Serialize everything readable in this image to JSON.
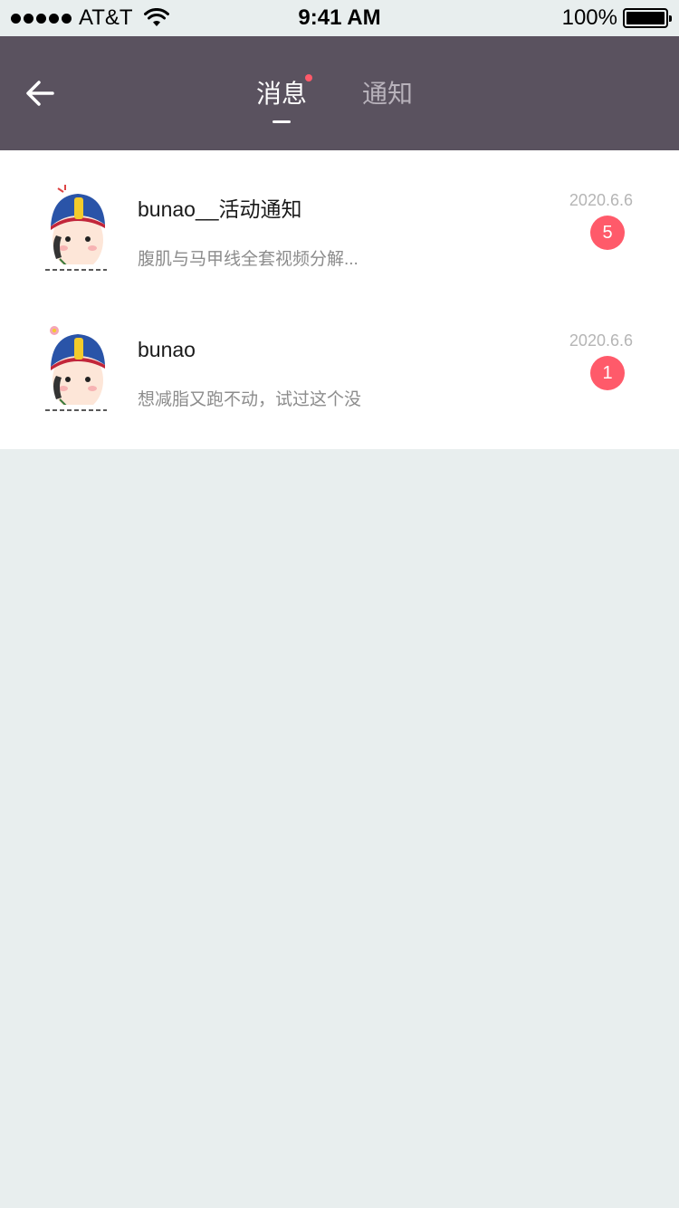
{
  "status_bar": {
    "carrier": "AT&T",
    "time": "9:41 AM",
    "battery": "100%",
    "signal_icon": "signal-dots-icon",
    "wifi_icon": "wifi-icon",
    "battery_icon": "battery-icon"
  },
  "nav": {
    "back_icon": "arrow-left-icon",
    "tabs": [
      {
        "label": "消息",
        "active": true,
        "has_dot": true
      },
      {
        "label": "通知",
        "active": false,
        "has_dot": false
      }
    ]
  },
  "messages": [
    {
      "name": "bunao__活动通知",
      "preview": "腹肌与马甲线全套视频分解...",
      "date": "2020.6.6",
      "badge": "5",
      "avatar_icon": "cartoon-avatar-icon"
    },
    {
      "name": "bunao",
      "preview": "想减脂又跑不动，试过这个没",
      "date": "2020.6.6",
      "badge": "1",
      "avatar_icon": "cartoon-avatar-icon"
    }
  ],
  "colors": {
    "nav_background": "#5a525f",
    "badge": "#ff5a6a",
    "page_background": "#e8eeee"
  }
}
